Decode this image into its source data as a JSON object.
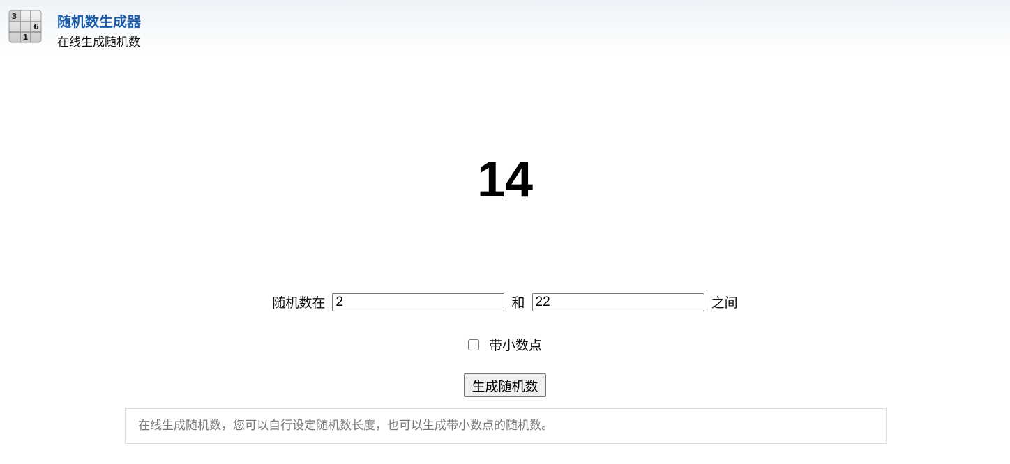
{
  "header": {
    "title": "随机数生成器",
    "subtitle": "在线生成随机数",
    "logo_icon": "sudoku-grid-icon",
    "logo_digits": [
      "3",
      "6",
      "1"
    ],
    "title_color": "#1b5aa8"
  },
  "result": {
    "value": "14"
  },
  "range": {
    "prefix": "随机数在",
    "min_value": "2",
    "joiner": "和",
    "max_value": "22",
    "suffix": "之间"
  },
  "decimal": {
    "label": "带小数点",
    "checked": false
  },
  "actions": {
    "generate_label": "生成随机数"
  },
  "info": {
    "text": "在线生成随机数，您可以自行设定随机数长度，也可以生成带小数点的随机数。"
  }
}
